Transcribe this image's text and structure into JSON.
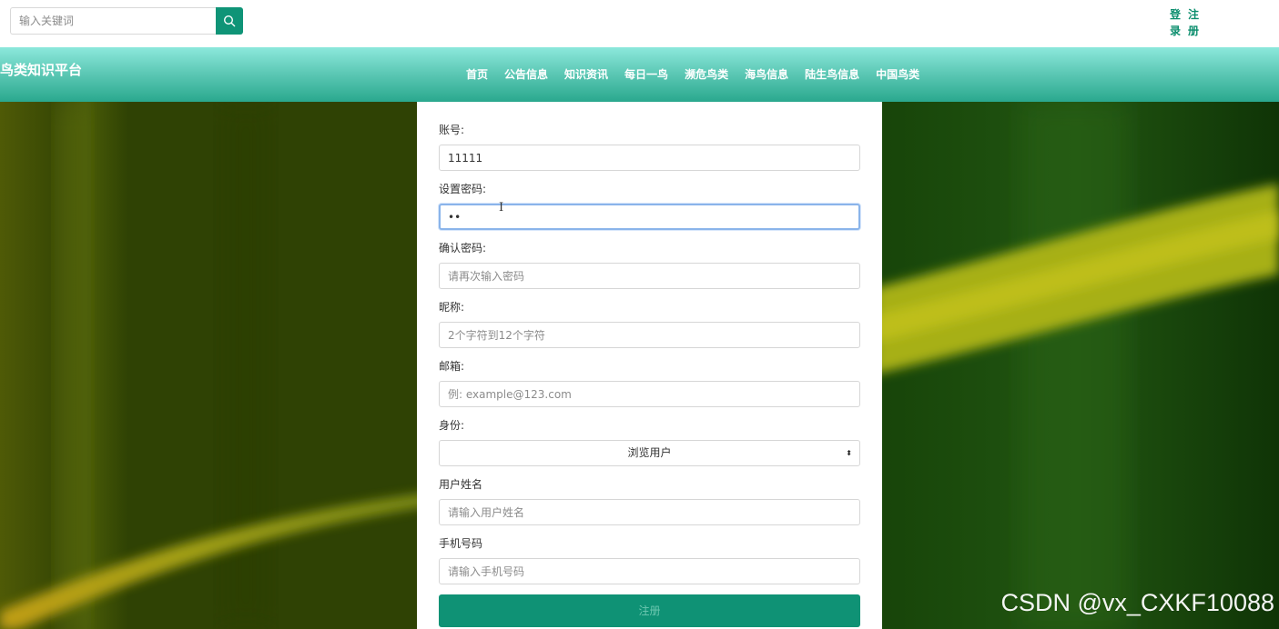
{
  "search": {
    "placeholder": "输入关键词",
    "icon": "search-icon"
  },
  "auth": {
    "login": [
      "登",
      "录"
    ],
    "register": [
      "注",
      "册"
    ]
  },
  "brand": "鸟类知识平台",
  "nav": [
    "首页",
    "公告信息",
    "知识资讯",
    "每日一鸟",
    "濒危鸟类",
    "海鸟信息",
    "陆生鸟信息",
    "中国鸟类"
  ],
  "form": {
    "account": {
      "label": "账号:",
      "value": "11111"
    },
    "password": {
      "label": "设置密码:",
      "value": "••"
    },
    "confirm": {
      "label": "确认密码:",
      "placeholder": "请再次输入密码"
    },
    "nickname": {
      "label": "昵称:",
      "placeholder": "2个字符到12个字符"
    },
    "email": {
      "label": "邮箱:",
      "placeholder": "例: example@123.com"
    },
    "role": {
      "label": "身份:",
      "selected": "浏览用户"
    },
    "username": {
      "label": "用户姓名",
      "placeholder": "请输入用户姓名"
    },
    "phone": {
      "label": "手机号码",
      "placeholder": "请输入手机号码"
    },
    "submit": "注册"
  },
  "watermark": "CSDN @vx_CXKF10088",
  "colors": {
    "accent": "#0f9477",
    "nav_top": "#8ce8dc",
    "nav_bottom": "#2aa88e"
  }
}
